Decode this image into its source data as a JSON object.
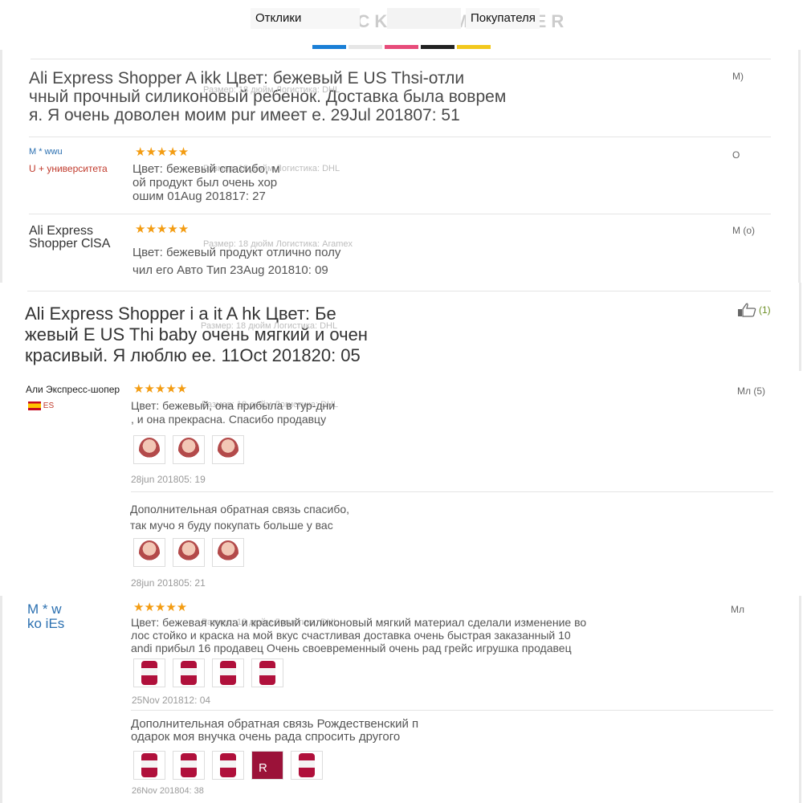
{
  "header": {
    "tab_reviews": "Отклики",
    "tab_buyer": "Покупателя",
    "stripes": [
      "#1a7fd6",
      "#e6e6e6",
      "#e74c7a",
      "#222222",
      "#f2c81d"
    ]
  },
  "reviews": [
    {
      "text": "Ali Express Shopper A ikk Цвет: бежевый E US Thsi-отли чный прочный силиконовый ребенок. Доставка была воврем я. Я очень доволен моим pur имеет е. 29Jul 201807: 51",
      "lines": [
        "Ali Express Shopper A ikk Цвет: бежевый E US Thsi-отли",
        "чный прочный силиконовый ребенок. Доставка была воврем",
        "я. Я очень доволен моим pur имеет е. 29Jul 201807: 51"
      ],
      "meta": "Размер: 18 дюйм Логистика: DHL",
      "side": "М)"
    },
    {
      "user": "М * wwu",
      "country": "U + университета",
      "stars": "★★★★★",
      "meta": "Размер: 18 дюйм Логистика: DHL",
      "lines": [
        "Цвет: бежевый спасибо, м",
        "ой продукт был очень хор",
        "ошим 01Aug 201817: 27"
      ],
      "side": "О"
    },
    {
      "user_lines": [
        "Ali Express",
        "Shopper ClSA"
      ],
      "stars": "★★★★★",
      "meta": "Размер: 18 дюйм Логистика: Aramex",
      "lines": [
        "Цвет: бежевый продукт отлично полу",
        "чил его Авто Тип 23Aug 201810: 09"
      ],
      "side": "М (о)"
    },
    {
      "lines": [
        "Ali Express Shopper i a it A hk Цвет: Бе",
        "жевый E US Thi baby очень мягкий и очен",
        "красивый. Я люблю ее. 11Oct 201820: 05"
      ],
      "meta": "Размер: 18 дюйм Логистика: DHL",
      "likes": "(1)"
    },
    {
      "user": "Али Экспресс-шопер",
      "country": "ES",
      "stars": "★★★★★",
      "meta": "Размер: 18 дюйм Логистика: DHL",
      "lines": [
        "Цвет: бежевый, она прибыла в тур-дни",
        ", и она прекрасна. Спасибо продавцу"
      ],
      "date": "28jun 201805: 19",
      "followup_lines": [
        "Дополнительная обратная связь спасибо,",
        "так мучо я буду покупать больше у вас"
      ],
      "followup_date": "28jun 201805: 21",
      "side": "Мл (5)"
    },
    {
      "user_lines": [
        "М * w",
        "ko iEs"
      ],
      "stars": "★★★★★",
      "meta": "Размер: 18 дюйм Логистика: DHL",
      "lines": [
        "Цвет: бежевая кукла и красивый силиконовый мягкий материал сделали изменение во",
        "лос стойко и краска на мой вкус счастливая доставка очень быстрая заказанный 10",
        "andi прибыл 16 продавец Очень своевременный очень рад грейс игрушка продавец"
      ],
      "date": "25Nov 201812: 04",
      "followup_lines": [
        "Дополнительная обратная связь Рождественский п",
        "одарок моя внучка очень рада спросить другого"
      ],
      "followup_date": "26Nov 201804: 38",
      "photo_badge": "R",
      "side": "Мл"
    }
  ]
}
